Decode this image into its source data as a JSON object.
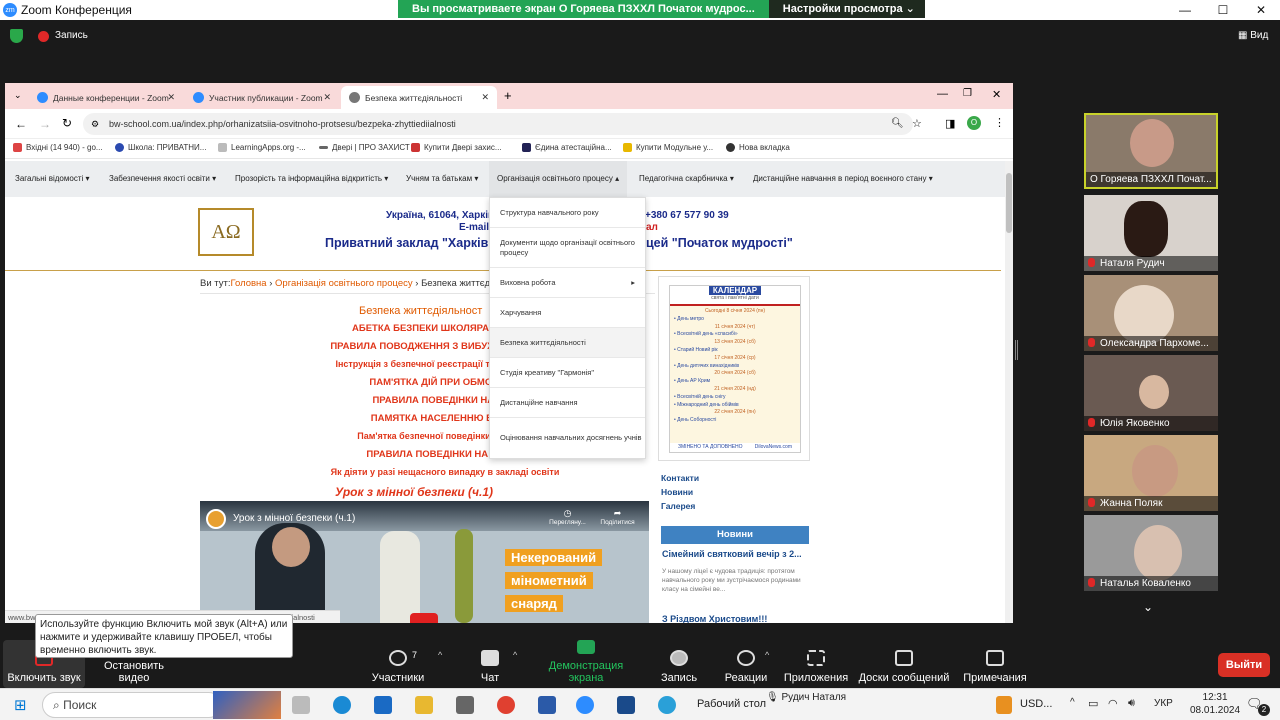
{
  "zoom_window": {
    "title": "Zoom Конференция",
    "share_banner": "Вы просматриваете экран О Горяева ПЗХХЛ Початок мудрос...",
    "view_options": "Настройки просмотра",
    "record_label": "Запись",
    "view_label": "Вид"
  },
  "browser": {
    "tabs": [
      {
        "label": "Данные конференции - Zoom"
      },
      {
        "label": "Участник публикации - Zoom"
      },
      {
        "label": "Безпека життєдіяльності"
      }
    ],
    "url": "bw-school.com.ua/index.php/orhanizatsiia-osvitnoho-protsesu/bezpeka-zhyttiediialnosti",
    "profile_initial": "O",
    "bookmarks": [
      "Вхідні (14 940) - go...",
      "Школа: ПРИВАТНИ...",
      "LearningApps.org -...",
      "Двері | ПРО ЗАХИСТ",
      "Купити Двері захис...",
      "Єдина атестаційна...",
      "Купити Модульне у...",
      "Нова вкладка"
    ],
    "status_url": "www.bw-school.com.ua/index.php/orhanizatsiia-osvitnoho-protsesu/bezpeka-zhyttiediialnosti"
  },
  "site": {
    "menu": [
      "Загальні відомості ▾",
      "Забезпечення якості освіти ▾",
      "Прозорість та інформаційна відкритість ▾",
      "Учням та батькам ▾",
      "Організація освітнього процесу ▴",
      "Педагогічна скарбничка ▾",
      "Дистанційне навчання в період воєнного стану ▾"
    ],
    "dropdown": [
      "Структура навчального року",
      "Документи щодо організації освітнього процесу",
      "Виховна робота",
      "Харчування",
      "Безпека життєдіяльності",
      "Студія креативу \"Гармонія\"",
      "Дистанційне навчання",
      "Оцінювання навчальних досягнень учнів"
    ],
    "dropdown_arrow": "▸",
    "logo": "ΑΩ",
    "header_address": "Україна, 61064, Харків",
    "header_phone": "+380 67 577 90 39",
    "header_email": "E-mail",
    "header_email_tail": "ал",
    "header_name_left": "Приватний заклад \"Харків",
    "header_name_right": "цей  \"Початок мудрості\"",
    "breadcrumb_prefix": "Ви тут:",
    "breadcrumb_home": "Головна",
    "breadcrumb_sep": "›",
    "breadcrumb_section": "Організація освітнього процесу",
    "breadcrumb_current": "Безпека життєді",
    "page_heading": "Безпека життєдіяльност",
    "links": [
      {
        "text": "АБЕТКА БЕЗПЕКИ ШКОЛЯРА СЕРЕДНЬ",
        "color": "#e0361a"
      },
      {
        "text": "ПРАВИЛА ПОВОДЖЕННЯ З ВИБУХОНЕБЕЗПЕЧН",
        "color": "#e0361a"
      },
      {
        "text": "Інструкція з безпечної реєстрації та використанн",
        "color": "#e0361a"
      },
      {
        "text": "ПАМ'ЯТКА ДІЙ ПРИ ОБМОРОЖЕ",
        "color": "#e0361a"
      },
      {
        "text": "ПРАВИЛА ПОВЕДІНКИ НА ЛЬО",
        "color": "#e0361a"
      },
      {
        "text": "ПАМЯТКА НАСЕЛЕННЮ ВІД ДО",
        "color": "#e0361a"
      },
      {
        "text": "Пам'ятка безпечної поведінки під час л",
        "color": "#e0361a"
      },
      {
        "text": "ПРАВИЛА ПОВЕДІНКИ НА ВОДІ В",
        "color": "#e0361a"
      },
      {
        "text": "Як діяти у разі нещасного випадку в закладі освіти",
        "color": "#e0361a"
      }
    ],
    "lesson_title": "Урок з мінної безпеки (ч.1)",
    "video": {
      "title": "Урок з мінної безпеки (ч.1)",
      "watch_later": "Перегляну...",
      "share": "Поділитися",
      "overlay_line1": "Некерований",
      "overlay_line2": "мінометний",
      "overlay_line3": "снаряд"
    },
    "calendar": {
      "header": "КАЛЕНДАР",
      "subheader": "свята і пам'ятні дати",
      "entries": [
        "Сьогодні 8 січня 2024 (пн)",
        "• День метро",
        "11 січня 2024 (чт)",
        "• Всесвітній день «спасибі»",
        "13 січня 2024 (сб)",
        "• Старий Новий рік",
        "17 січня 2024 (ср)",
        "• День дитячих винахідників",
        "20 січня 2024 (сб)",
        "• День АР Крим",
        "21 січня 2024 (нд)",
        "• Всесвітній день снігу",
        "• Міжнародний день обіймів",
        "22 січня 2024 (пн)",
        "• День Соборності"
      ],
      "footer_left": "ЗМІНЕНО ТА ДОПОВНЕНО",
      "footer_right": "DilovaNews.com"
    },
    "side_links": [
      "Контакти",
      "Новини",
      "Галерея"
    ],
    "news_header": "Новини",
    "news_item_title": "Сімейний святковий вечір з 2...",
    "news_item_text": "У нашому ліцеї є чудова традиція: протягом навчального року ми зустрічаємося родинами класу на сімейні ве...",
    "news_item2_title": "З Різдвом Христовим!!!"
  },
  "participants": [
    {
      "name": "О Горяева ПЗХХЛ Почат..."
    },
    {
      "name": "Наталя Рудич"
    },
    {
      "name": "Олександра Пархоме..."
    },
    {
      "name": "Юлія Яковенко"
    },
    {
      "name": "Жанна Поляк"
    },
    {
      "name": "Наталья Коваленко"
    }
  ],
  "tooltip": "Используйте функцию Включить мой звук (Alt+A) или нажмите и удерживайте клавишу ПРОБЕЛ, чтобы временно включить звук.",
  "toolbar": {
    "mute": "Включить звук",
    "video": "Остановить видео",
    "participants": "Участники",
    "participants_count": "7",
    "chat": "Чат",
    "share": "Демонстрация экрана",
    "record": "Запись",
    "reactions": "Реакции",
    "apps": "Приложения",
    "whiteboard": "Доски сообщений",
    "notes": "Примечания",
    "leave": "Выйти"
  },
  "taskbar": {
    "search": "Поиск",
    "desktop": "Рабочий стол",
    "speaker_name": "Рудич Наталя",
    "currency": "USD...",
    "lang": "УКР",
    "time": "12:31",
    "date": "08.01.2024",
    "notif_count": "2"
  },
  "colors": {
    "zoom_green": "#23a455",
    "leave_red": "#d93025",
    "news_blue": "#3f82c2",
    "link_orange": "#e0361a",
    "active_speaker_border": "#c8d22a"
  }
}
